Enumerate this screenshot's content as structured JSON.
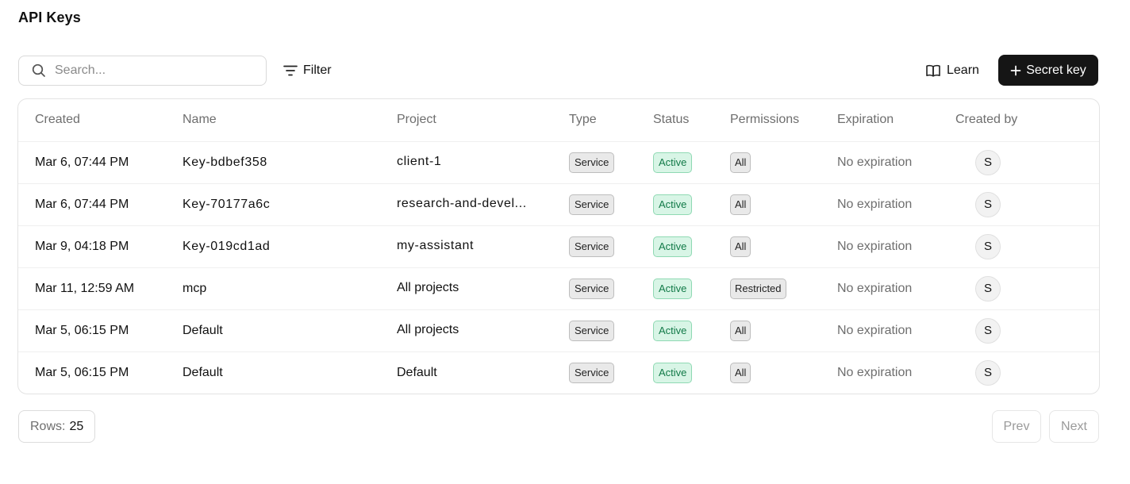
{
  "page": {
    "title": "API Keys"
  },
  "toolbar": {
    "search_placeholder": "Search...",
    "filter_label": "Filter",
    "learn_label": "Learn",
    "secret_key_label": "Secret key"
  },
  "table": {
    "headers": [
      "Created",
      "Name",
      "Project",
      "Type",
      "Status",
      "Permissions",
      "Expiration",
      "Created by"
    ],
    "rows": [
      {
        "created": "Mar 6, 07:44 PM",
        "name": "Key-bdbef358",
        "project": "client-1",
        "type": "Service",
        "status": "Active",
        "permissions": "All",
        "expiration": "No expiration",
        "created_by": "S"
      },
      {
        "created": "Mar 6, 07:44 PM",
        "name": "Key-70177a6c",
        "project": "research-and-devel...",
        "type": "Service",
        "status": "Active",
        "permissions": "All",
        "expiration": "No expiration",
        "created_by": "S"
      },
      {
        "created": "Mar 9, 04:18 PM",
        "name": "Key-019cd1ad",
        "project": "my-assistant",
        "type": "Service",
        "status": "Active",
        "permissions": "All",
        "expiration": "No expiration",
        "created_by": "S"
      },
      {
        "created": "Mar 11, 12:59 AM",
        "name": "mcp",
        "project": "All projects",
        "type": "Service",
        "status": "Active",
        "permissions": "Restricted",
        "expiration": "No expiration",
        "created_by": "S"
      },
      {
        "created": "Mar 5, 06:15 PM",
        "name": "Default",
        "project": "All projects",
        "type": "Service",
        "status": "Active",
        "permissions": "All",
        "expiration": "No expiration",
        "created_by": "S"
      },
      {
        "created": "Mar 5, 06:15 PM",
        "name": "Default",
        "project": "Default",
        "type": "Service",
        "status": "Active",
        "permissions": "All",
        "expiration": "No expiration",
        "created_by": "S"
      }
    ]
  },
  "footer": {
    "rows_label": "Rows:",
    "rows_value": "25",
    "prev_label": "Prev",
    "next_label": "Next"
  },
  "colors": {
    "primary_button": "#151515",
    "active_badge_bg": "#d8f5e6",
    "active_badge_text": "#127a48"
  }
}
